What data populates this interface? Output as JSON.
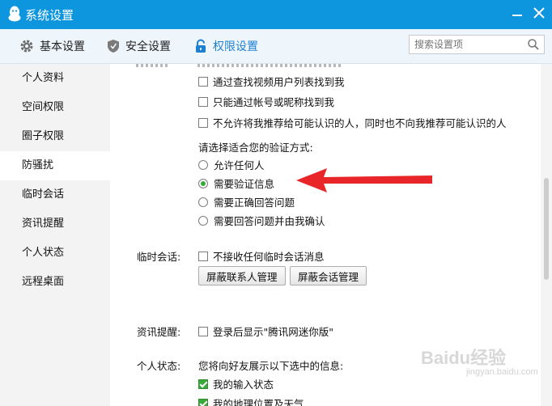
{
  "window": {
    "title": "系统设置"
  },
  "tabs": {
    "basic": "基本设置",
    "security": "安全设置",
    "permission": "权限设置"
  },
  "search": {
    "placeholder": "搜索设置项"
  },
  "sidebar": {
    "items": [
      {
        "label": "个人资料"
      },
      {
        "label": "空间权限"
      },
      {
        "label": "圈子权限"
      },
      {
        "label": "防骚扰"
      },
      {
        "label": "临时会话"
      },
      {
        "label": "资讯提醒"
      },
      {
        "label": "个人状态"
      },
      {
        "label": "远程桌面"
      }
    ]
  },
  "anti_harass": {
    "options": [
      {
        "label": "通过查找视频用户列表找到我",
        "checked": false
      },
      {
        "label": "只能通过帐号或昵称找到我",
        "checked": false
      },
      {
        "label": "不允许将我推荐给可能认识的人，同时也不向我推荐可能认识的人",
        "checked": false
      }
    ],
    "verify_prompt": "请选择适合您的验证方式:",
    "verify_options": [
      {
        "label": "允许任何人",
        "selected": false
      },
      {
        "label": "需要验证信息",
        "selected": true
      },
      {
        "label": "需要正确回答问题",
        "selected": false
      },
      {
        "label": "需要回答问题并由我确认",
        "selected": false
      }
    ]
  },
  "temp_session": {
    "section_label": "临时会话:",
    "option": "不接收任何临时会话消息",
    "block_contacts_button": "屏蔽联系人管理",
    "block_sessions_button": "屏蔽会话管理"
  },
  "news": {
    "section_label": "资讯提醒:",
    "option": "登录后显示\"腾讯网迷你版\""
  },
  "status": {
    "section_label": "个人状态:",
    "prompt": "您将向好友展示以下选中的信息:",
    "options": [
      {
        "label": "我的输入状态",
        "checked": true
      },
      {
        "label": "我的地理位置及天气",
        "checked": true
      }
    ]
  },
  "watermark": {
    "text": "Baidu经验",
    "sub": "jingyan.baidu.com"
  },
  "colors": {
    "titlebar": "#0d95dd",
    "accent": "#1f7fd1",
    "check_green": "#3aa93c",
    "arrow_red": "#e8262a"
  }
}
